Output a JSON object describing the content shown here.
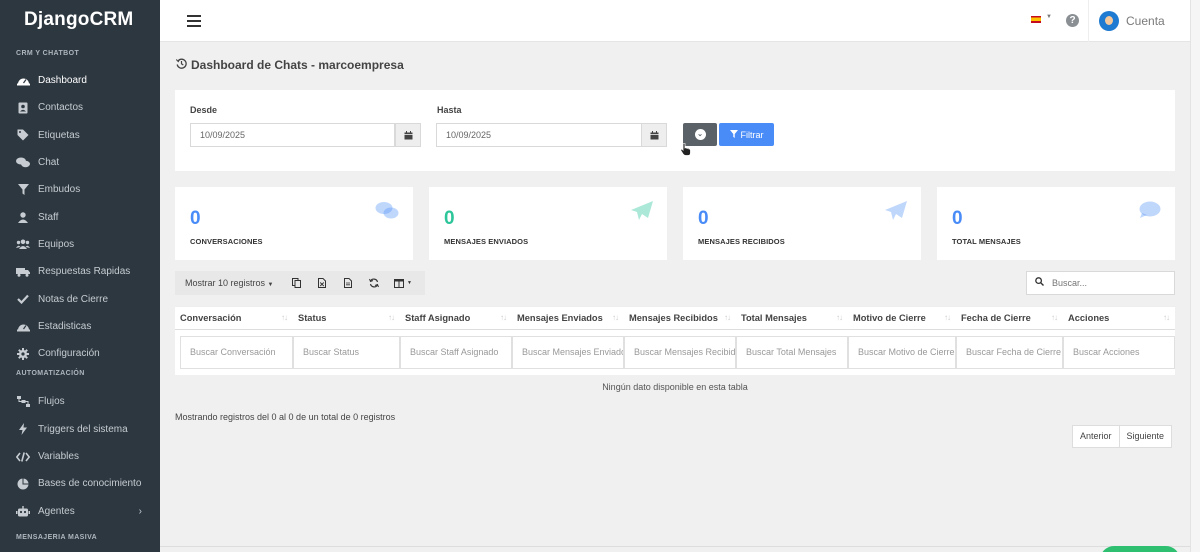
{
  "brand": "DjangoCRM",
  "sidebar": {
    "section_crm": "CRM Y CHATBOT",
    "section_auto": "AUTOMATIZACIÓN",
    "section_mass": "MENSAJERIA MASIVA",
    "items": [
      {
        "label": "Dashboard",
        "icon": "dashboard-icon"
      },
      {
        "label": "Contactos",
        "icon": "address-book-icon"
      },
      {
        "label": "Etiquetas",
        "icon": "tag-icon"
      },
      {
        "label": "Chat",
        "icon": "chat-bubbles-icon"
      },
      {
        "label": "Embudos",
        "icon": "funnel-icon"
      },
      {
        "label": "Staff",
        "icon": "user-icon"
      },
      {
        "label": "Equipos",
        "icon": "users-icon"
      },
      {
        "label": "Respuestas Rapidas",
        "icon": "truck-icon"
      },
      {
        "label": "Notas de Cierre",
        "icon": "check-icon"
      },
      {
        "label": "Estadisticas",
        "icon": "gauge-icon"
      },
      {
        "label": "Configuración",
        "icon": "gear-icon"
      }
    ],
    "auto_items": [
      {
        "label": "Flujos",
        "icon": "sitemap-icon"
      },
      {
        "label": "Triggers del sistema",
        "icon": "bolt-icon"
      },
      {
        "label": "Variables",
        "icon": "code-icon"
      },
      {
        "label": "Bases de conocimiento",
        "icon": "pie-chart-icon"
      },
      {
        "label": "Agentes",
        "icon": "robot-icon"
      }
    ]
  },
  "topbar": {
    "account_label": "Cuenta",
    "language": "es"
  },
  "page": {
    "title": "Dashboard de Chats - marcoempresa"
  },
  "filters": {
    "from_label": "Desde",
    "from_value": "10/09/2025",
    "to_label": "Hasta",
    "to_value": "10/09/2025",
    "filter_button": "Filtrar"
  },
  "stats": [
    {
      "value": "0",
      "label": "CONVERSACIONES",
      "icon": "comments-icon",
      "color": "#4a8cf7"
    },
    {
      "value": "0",
      "label": "MENSAJES ENVIADOS",
      "icon": "paper-plane-icon",
      "color": "#2dc59a"
    },
    {
      "value": "0",
      "label": "MENSAJES RECIBIDOS",
      "icon": "paper-plane-icon",
      "color": "#4a8cf7"
    },
    {
      "value": "0",
      "label": "TOTAL MENSAJES",
      "icon": "comment-icon",
      "color": "#4a8cf7"
    }
  ],
  "table_toolbar": {
    "show_label": "Mostrar 10 registros",
    "search_placeholder": "Buscar..."
  },
  "table": {
    "columns": [
      "Conversación",
      "Status",
      "Staff Asignado",
      "Mensajes Enviados",
      "Mensajes Recibidos",
      "Total Mensajes",
      "Motivo de Cierre",
      "Fecha de Cierre",
      "Acciones"
    ],
    "column_filters": [
      "Buscar Conversación",
      "Buscar Status",
      "Buscar Staff Asignado",
      "Buscar Mensajes Enviados",
      "Buscar Mensajes Recibidos",
      "Buscar Total Mensajes",
      "Buscar Motivo de Cierre",
      "Buscar Fecha de Cierre",
      "Buscar Acciones"
    ],
    "empty_message": "Ningún dato disponible en esta tabla"
  },
  "records_info": "Mostrando registros del 0 al 0 de un total de 0 registros",
  "pagination": {
    "prev": "Anterior",
    "next": "Siguiente"
  }
}
